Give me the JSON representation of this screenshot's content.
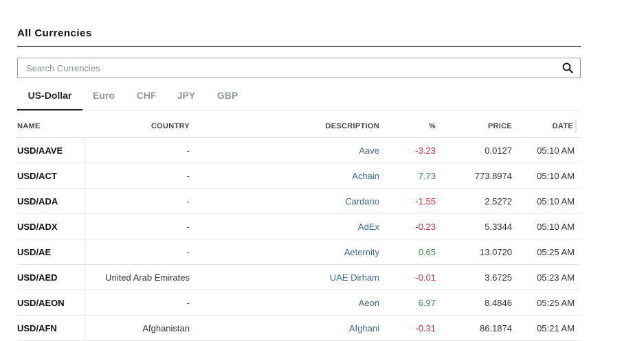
{
  "page": {
    "title": "All Currencies"
  },
  "search": {
    "placeholder": "Search Currencies",
    "icon": "search-icon"
  },
  "tabs": [
    {
      "label": "US-Dollar",
      "active": true
    },
    {
      "label": "Euro",
      "active": false
    },
    {
      "label": "CHF",
      "active": false
    },
    {
      "label": "JPY",
      "active": false
    },
    {
      "label": "GBP",
      "active": false
    }
  ],
  "table": {
    "headers": {
      "name": "NAME",
      "country": "COUNTRY",
      "description": "DESCRIPTION",
      "percent": "%",
      "price": "PRICE",
      "date": "DATE"
    },
    "rows": [
      {
        "name": "USD/AAVE",
        "country": "-",
        "description": "Aave",
        "percent": "-3.23",
        "price": "0.0127",
        "date": "05:10 AM"
      },
      {
        "name": "USD/ACT",
        "country": "-",
        "description": "Achain",
        "percent": "7.73",
        "price": "773.8974",
        "date": "05:10 AM"
      },
      {
        "name": "USD/ADA",
        "country": "-",
        "description": "Cardano",
        "percent": "-1.55",
        "price": "2.5272",
        "date": "05:10 AM"
      },
      {
        "name": "USD/ADX",
        "country": "-",
        "description": "AdEx",
        "percent": "-0.23",
        "price": "5.3344",
        "date": "05:10 AM"
      },
      {
        "name": "USD/AE",
        "country": "-",
        "description": "Aeternity",
        "percent": "0.65",
        "price": "13.0720",
        "date": "05:25 AM"
      },
      {
        "name": "USD/AED",
        "country": "United Arab Emirates",
        "description": "UAE Dirham",
        "percent": "-0.01",
        "price": "3.6725",
        "date": "05:23 AM"
      },
      {
        "name": "USD/AEON",
        "country": "-",
        "description": "Aeon",
        "percent": "6.97",
        "price": "8.4846",
        "date": "05:25 AM"
      },
      {
        "name": "USD/AFN",
        "country": "Afghanistan",
        "description": "Afghani",
        "percent": "-0.31",
        "price": "86.1874",
        "date": "05:21 AM"
      }
    ]
  },
  "colors": {
    "negative": "#d0323c",
    "positive": "#3c8a4c",
    "link": "#3d6b8f"
  }
}
